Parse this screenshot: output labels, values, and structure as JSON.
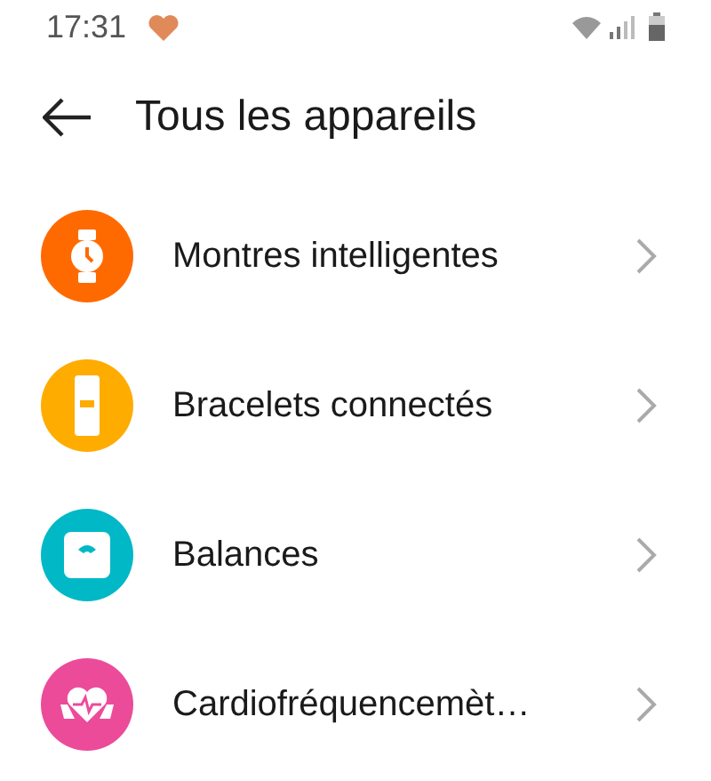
{
  "status_bar": {
    "time": "17:31"
  },
  "header": {
    "title": "Tous les appareils"
  },
  "items": [
    {
      "kind": "watch",
      "label": "Montres intelligentes",
      "color": "#ff6a00"
    },
    {
      "kind": "band",
      "label": "Bracelets connectés",
      "color": "#ffac00"
    },
    {
      "kind": "scale",
      "label": "Balances",
      "color": "#00b8c6"
    },
    {
      "kind": "heart",
      "label": "Cardiofréquencemèt…",
      "color": "#ec4b9a"
    }
  ]
}
